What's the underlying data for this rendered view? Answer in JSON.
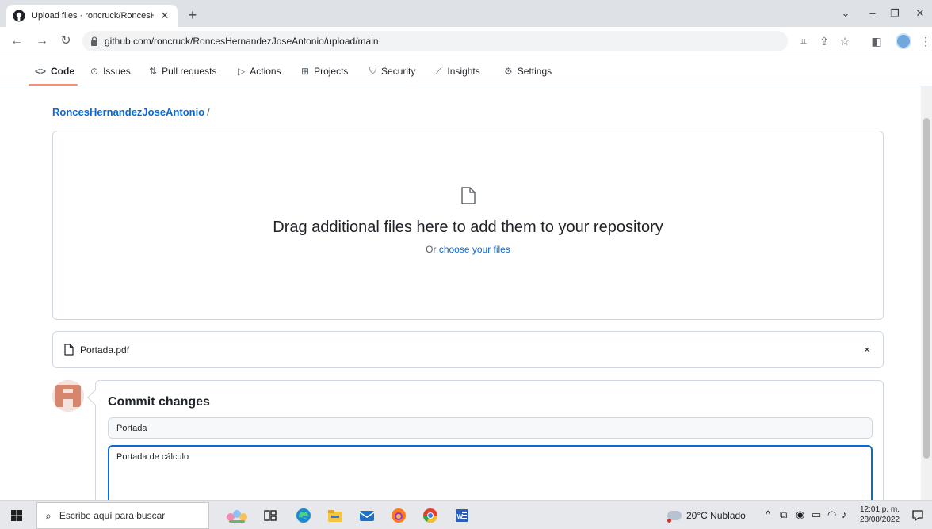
{
  "browser": {
    "tab_title": "Upload files · roncruck/RoncesHe",
    "tab_close": "✕",
    "new_tab": "+",
    "url": "github.com/roncruck/RoncesHernandezJoseAntonio/upload/main"
  },
  "repo_nav": {
    "items": [
      {
        "label": "Code",
        "icon": "<>"
      },
      {
        "label": "Issues",
        "icon": "⊙"
      },
      {
        "label": "Pull requests",
        "icon": "⇅"
      },
      {
        "label": "Actions",
        "icon": "▷"
      },
      {
        "label": "Projects",
        "icon": "⊞"
      },
      {
        "label": "Security",
        "icon": "⛉"
      },
      {
        "label": "Insights",
        "icon": "⟋"
      },
      {
        "label": "Settings",
        "icon": "⚙"
      }
    ]
  },
  "breadcrumb": {
    "repo": "RoncesHernandezJoseAntonio",
    "separator": "/"
  },
  "dropzone": {
    "title": "Drag additional files here to add them to your repository",
    "or_text": "Or",
    "choose_link": "choose your files"
  },
  "uploaded_file": {
    "name": "Portada.pdf",
    "remove": "×"
  },
  "commit": {
    "title": "Commit changes",
    "summary_value": "Portada",
    "description_value": "Portada de cálculo"
  },
  "taskbar": {
    "search_placeholder": "Escribe aquí para buscar",
    "weather": "20°C  Nublado",
    "time": "12:01 p. m.",
    "date": "28/08/2022"
  },
  "colors": {
    "link": "#0969da",
    "active_tab_underline": "#fd8c73",
    "focus_border": "#0969da"
  }
}
